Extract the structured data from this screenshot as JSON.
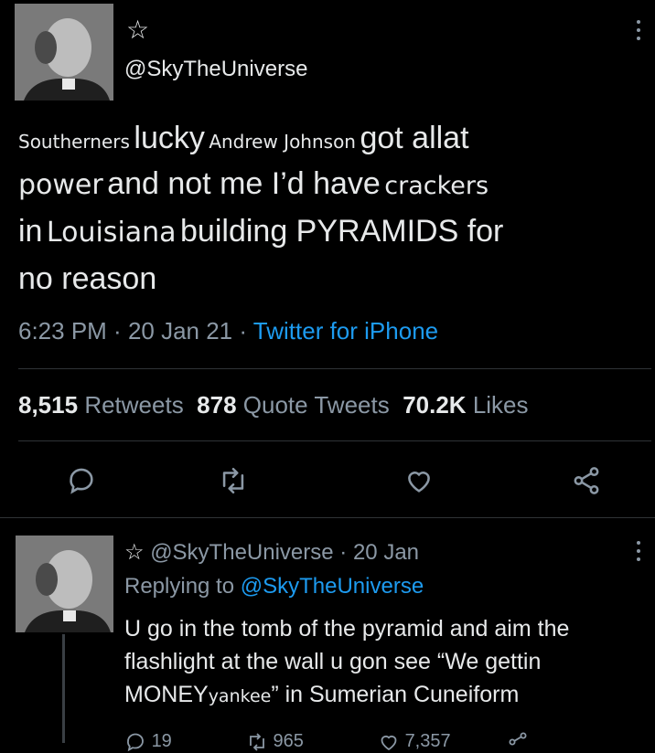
{
  "tweet": {
    "star": "☆",
    "handle": "@SkyTheUniverse",
    "text_parts": [
      "Southerners",
      "lucky",
      "Andrew Johnson",
      "got allat",
      "power",
      "and not me I’d have",
      "crackers",
      "in",
      "Louisiana",
      "building PYRAMIDS for",
      "no reason"
    ],
    "time": "6:23 PM",
    "date": "20 Jan 21",
    "client": "Twitter for iPhone",
    "retweets_count": "8,515",
    "retweets_label": "Retweets",
    "quotes_count": "878",
    "quotes_label": "Quote Tweets",
    "likes_count": "70.2K",
    "likes_label": "Likes"
  },
  "reply": {
    "star": "☆",
    "handle": "@SkyTheUniverse",
    "date": "20 Jan",
    "replying_prefix": "Replying to",
    "replying_handle": "@SkyTheUniverse",
    "line1": "U go in the tomb of the pyramid and aim the",
    "line2": "flashlight at the wall u gon see “We gettin",
    "line3_a": "MONEY",
    "line3_b": "yankee",
    "line3_c": "” in Sumerian Cuneiform",
    "reply_count": "19",
    "retweet_count": "965",
    "like_count": "7,357"
  },
  "icons": {
    "reply": "reply-icon",
    "retweet": "retweet-icon",
    "like": "heart-icon",
    "share": "share-icon",
    "more": "more-icon"
  },
  "colors": {
    "background": "#000000",
    "text": "#e7e9ea",
    "muted": "#8b98a5",
    "link": "#1d9bf0"
  }
}
